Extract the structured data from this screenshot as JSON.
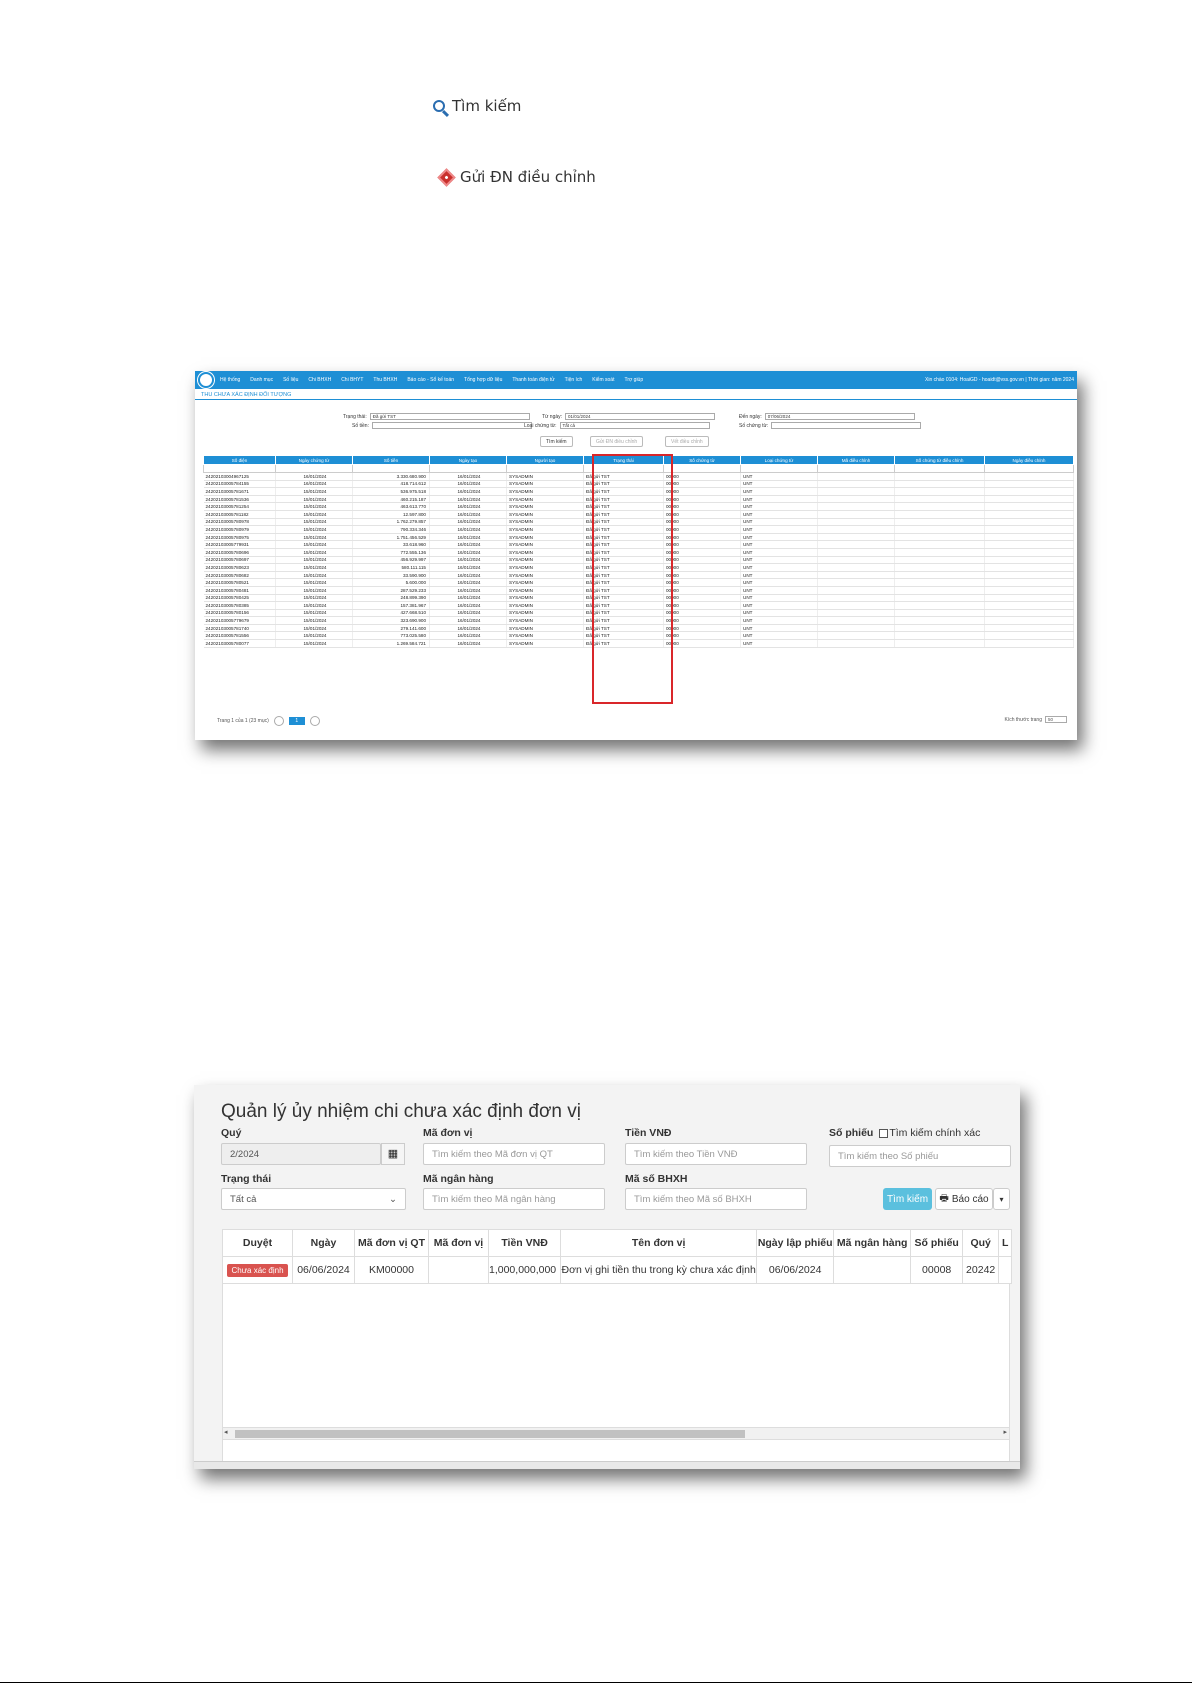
{
  "top_buttons": {
    "search": "Tìm kiếm",
    "send_adjust": "Gửi ĐN điều chỉnh"
  },
  "shot1": {
    "nav": [
      "Hệ thống",
      "Danh mục",
      "Số liệu",
      "Chi BHXH",
      "Chi BHYT",
      "Thu BHXH",
      "Báo cáo - Sổ kế toán",
      "Tổng hợp dữ liệu",
      "Thanh toán điện tử",
      "Tiện ích",
      "Kiểm soát",
      "Trợ giúp"
    ],
    "nav_right": "Xin chào 0104: HoaiGD - hoaidt@vss.gov.vn | Thời gian: năm 2024",
    "title": "THU CHƯA XÁC ĐỊNH ĐỐI TƯỢNG",
    "form": {
      "trang_thai_label": "Trạng thái:",
      "trang_thai_value": "Đã gửi TST",
      "so_tien_label": "Số tiền:",
      "tu_ngay_label": "Từ ngày:",
      "tu_ngay_value": "01/01/2024",
      "loai_chung_tu_label": "Loại chứng từ:",
      "loai_chung_tu_value": "Tất cả",
      "den_ngay_label": "Đến ngày:",
      "den_ngay_value": "07/06/2024",
      "so_chung_tu_label": "Số chứng từ:"
    },
    "buttons": {
      "search": "Tìm kiếm",
      "send": "Gửi ĐN điều chỉnh",
      "history": "Vết điều chỉnh"
    },
    "columns": [
      "Số điện",
      "Ngày chứng từ",
      "Số tiền",
      "Ngày tạo",
      "Người tạo",
      "Trạng thái",
      "Số chứng từ",
      "Loại chứng từ",
      "Mã điều chỉnh",
      "Số chứng từ điều chỉnh",
      "Ngày điều chỉnh"
    ],
    "rows": [
      [
        "24202103004967125",
        "16/01/2024",
        "3.330.680.900",
        "16/01/2024",
        "SYSADMIN",
        "Đã gửi TST",
        "00000",
        "UNT"
      ],
      [
        "24202103005784155",
        "16/01/2024",
        "418.714.612",
        "16/01/2024",
        "SYSADMIN",
        "Đã gửi TST",
        "00000",
        "UNT"
      ],
      [
        "24202103005781671",
        "15/01/2024",
        "536.975.518",
        "16/01/2024",
        "SYSADMIN",
        "Đã gửi TST",
        "00000",
        "UNT"
      ],
      [
        "24202103005781536",
        "15/01/2024",
        "460.215.187",
        "16/01/2024",
        "SYSADMIN",
        "Đã gửi TST",
        "00000",
        "UNT"
      ],
      [
        "24202103005781254",
        "15/01/2024",
        "463.613.770",
        "16/01/2024",
        "SYSADMIN",
        "Đã gửi TST",
        "00000",
        "UNT"
      ],
      [
        "24202103005781182",
        "15/01/2024",
        "12.597.800",
        "16/01/2024",
        "SYSADMIN",
        "Đã gửi TST",
        "00000",
        "UNT"
      ],
      [
        "24202103005780978",
        "15/01/2024",
        "1.762.279.857",
        "16/01/2024",
        "SYSADMIN",
        "Đã gửi TST",
        "00000",
        "UNT"
      ],
      [
        "24202103005780979",
        "15/01/2024",
        "790.334.346",
        "16/01/2024",
        "SYSADMIN",
        "Đã gửi TST",
        "00000",
        "UNT"
      ],
      [
        "24202103005780975",
        "15/01/2024",
        "1.751.456.529",
        "16/01/2024",
        "SYSADMIN",
        "Đã gửi TST",
        "00000",
        "UNT"
      ],
      [
        "24202103005779931",
        "15/01/2024",
        "33.618.960",
        "16/01/2024",
        "SYSADMIN",
        "Đã gửi TST",
        "00000",
        "UNT"
      ],
      [
        "24202103005780696",
        "15/01/2024",
        "772.555.136",
        "16/01/2024",
        "SYSADMIN",
        "Đã gửi TST",
        "00000",
        "UNT"
      ],
      [
        "24202103005780697",
        "15/01/2024",
        "456.929.997",
        "16/01/2024",
        "SYSADMIN",
        "Đã gửi TST",
        "00000",
        "UNT"
      ],
      [
        "24202103005780623",
        "15/01/2024",
        "580.111.115",
        "16/01/2024",
        "SYSADMIN",
        "Đã gửi TST",
        "00000",
        "UNT"
      ],
      [
        "24202103005780682",
        "15/01/2024",
        "33.590.900",
        "16/01/2024",
        "SYSADMIN",
        "Đã gửi TST",
        "00000",
        "UNT"
      ],
      [
        "24202103005780521",
        "15/01/2024",
        "5.600.000",
        "16/01/2024",
        "SYSADMIN",
        "Đã gửi TST",
        "00000",
        "UNT"
      ],
      [
        "24202103005780481",
        "15/01/2024",
        "287.529.233",
        "16/01/2024",
        "SYSADMIN",
        "Đã gửi TST",
        "00000",
        "UNT"
      ],
      [
        "24202103005780425",
        "15/01/2024",
        "248.899.390",
        "16/01/2024",
        "SYSADMIN",
        "Đã gửi TST",
        "00000",
        "UNT"
      ],
      [
        "24202103005780385",
        "15/01/2024",
        "157.381.967",
        "16/01/2024",
        "SYSADMIN",
        "Đã gửi TST",
        "00000",
        "UNT"
      ],
      [
        "24202103005780156",
        "15/01/2024",
        "427.668.510",
        "16/01/2024",
        "SYSADMIN",
        "Đã gửi TST",
        "00000",
        "UNT"
      ],
      [
        "24202103005779679",
        "15/01/2024",
        "323.690.900",
        "16/01/2024",
        "SYSADMIN",
        "Đã gửi TST",
        "00000",
        "UNT"
      ],
      [
        "24202103005781740",
        "15/01/2024",
        "279.141.600",
        "16/01/2024",
        "SYSADMIN",
        "Đã gửi TST",
        "00000",
        "UNT"
      ],
      [
        "24202103005781556",
        "15/01/2024",
        "773.025.580",
        "16/01/2024",
        "SYSADMIN",
        "Đã gửi TST",
        "00000",
        "UNT"
      ],
      [
        "24202103005780077",
        "15/01/2024",
        "1.269.584.721",
        "16/01/2024",
        "SYSADMIN",
        "Đã gửi TST",
        "00000",
        "UNT"
      ]
    ],
    "pager": "Trang 1 của 1 (23 mục)",
    "page_current": "1",
    "page_size_label": "Kích thước trang",
    "page_size": "50"
  },
  "shot2": {
    "title": "Quản lý ủy nhiệm chi chưa xác định đơn vị",
    "labels": {
      "quy": "Quý",
      "ma_don_vi": "Mã đơn vị",
      "tien_vnd": "Tiền VNĐ",
      "so_phieu": "Số phiếu",
      "exact": "Tìm kiếm chính xác",
      "trang_thai": "Trạng thái",
      "ma_ngan_hang": "Mã ngân hàng",
      "ma_so_bhxh": "Mã số BHXH"
    },
    "values": {
      "quy": "2/2024",
      "trang_thai": "Tất cả"
    },
    "placeholders": {
      "ma_don_vi": "Tìm kiếm theo Mã đơn vị QT",
      "tien_vnd": "Tìm kiếm theo Tiền VNĐ",
      "so_phieu": "Tìm kiếm theo Số phiếu",
      "ma_ngan_hang": "Tìm kiếm theo Mã ngân hàng",
      "ma_so_bhxh": "Tìm kiếm theo Mã số BHXH"
    },
    "buttons": {
      "search": "Tìm kiếm",
      "report": "Báo cáo"
    },
    "columns": [
      "Duyệt",
      "Ngày",
      "Mã đơn vị QT",
      "Mã đơn vị",
      "Tiền VNĐ",
      "Tên đơn vị",
      "Ngày lập phiếu",
      "Mã ngân hàng",
      "Số phiếu",
      "Quý",
      "L"
    ],
    "row": {
      "status": "Chưa xác định",
      "ngay": "06/06/2024",
      "ma_qt": "KM00000",
      "ma_dv": "",
      "tien": "1,000,000,000",
      "ten": "Đơn vị ghi tiền thu trong kỳ chưa xác định",
      "ngay_lap": "06/06/2024",
      "ma_nh": "",
      "so_phieu": "00008",
      "quy": "20242"
    }
  },
  "colors": {
    "accent": "#1e8fd5",
    "highlight_box": "#d9262a",
    "badge": "#d9534f",
    "search_btn": "#5bc0de"
  }
}
